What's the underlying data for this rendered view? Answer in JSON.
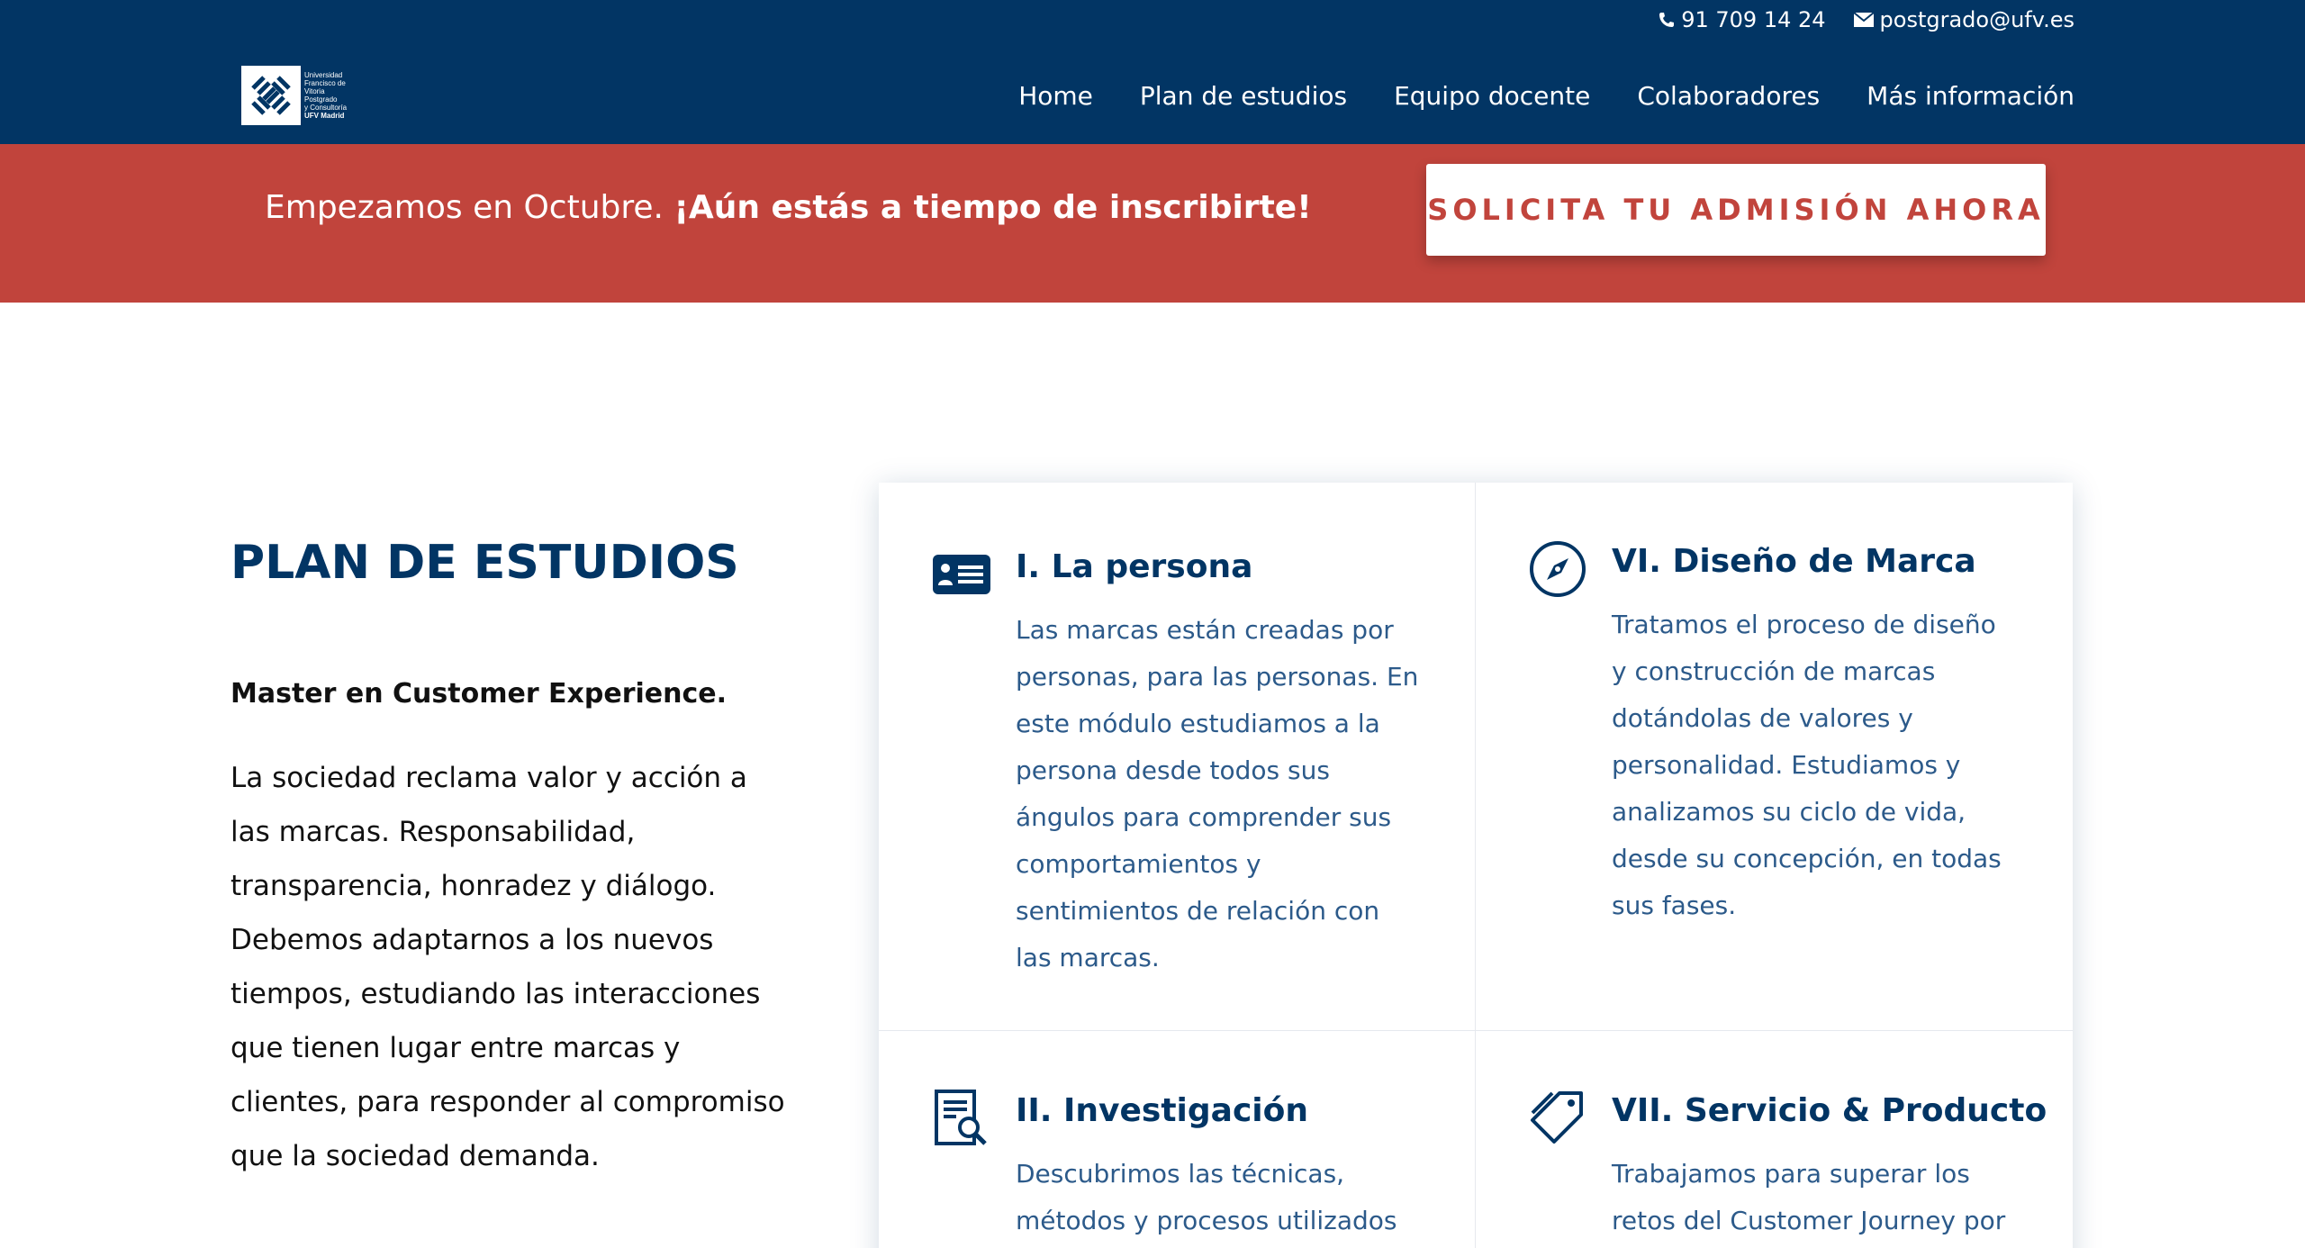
{
  "header": {
    "phone": "91 709 14 24",
    "email": "postgrado@ufv.es",
    "logo": {
      "lines": [
        "Universidad",
        "Francisco de",
        "Vitoria",
        "Postgrado",
        "y Consultoría",
        "UFV Madrid"
      ],
      "icon": "ufv-logo-icon"
    },
    "nav": [
      "Home",
      "Plan de estudios",
      "Equipo docente",
      "Colaboradores",
      "Más información"
    ]
  },
  "banner": {
    "text_regular": "Empezamos en Octubre. ",
    "text_bold": "¡Aún estás a tiempo de inscribirte!",
    "cta": "Solicita tu admisión ahora"
  },
  "intro": {
    "title": "PLAN DE ESTUDIOS",
    "subtitle": "Master en Customer Experience.",
    "body": "La sociedad reclama valor y acción a las marcas. Responsabilidad, transparencia, honradez y diálogo. Debemos adaptarnos a los nuevos tiempos, estudiando las interacciones que tienen lugar entre marcas y clientes, para responder al compromiso que la sociedad demanda."
  },
  "modules": [
    {
      "title": "I. La persona",
      "icon": "id-card-icon",
      "text": "Las marcas están creadas por personas, para las personas. En este módulo estudiamos a la persona desde todos sus ángulos para comprender sus comportamientos y sentimientos de relación con las marcas."
    },
    {
      "title": "VI. Diseño de Marca",
      "icon": "compass-icon",
      "text": "Tratamos el proceso de diseño y construcción de marcas dotándolas de valores y personalidad. Estudiamos y analizamos su ciclo de vida, desde su concepción, en todas sus fases."
    },
    {
      "title": "II. Investigación",
      "icon": "document-search-icon",
      "text": "Descubrimos las técnicas, métodos y procesos utilizados"
    },
    {
      "title": "VII. Servicio & Producto",
      "icon": "tags-icon",
      "text": "Trabajamos para superar los retos del Customer Journey por"
    }
  ],
  "colors": {
    "navy": "#023564",
    "red": "#c1443c",
    "module_text": "#2c5a8a"
  }
}
